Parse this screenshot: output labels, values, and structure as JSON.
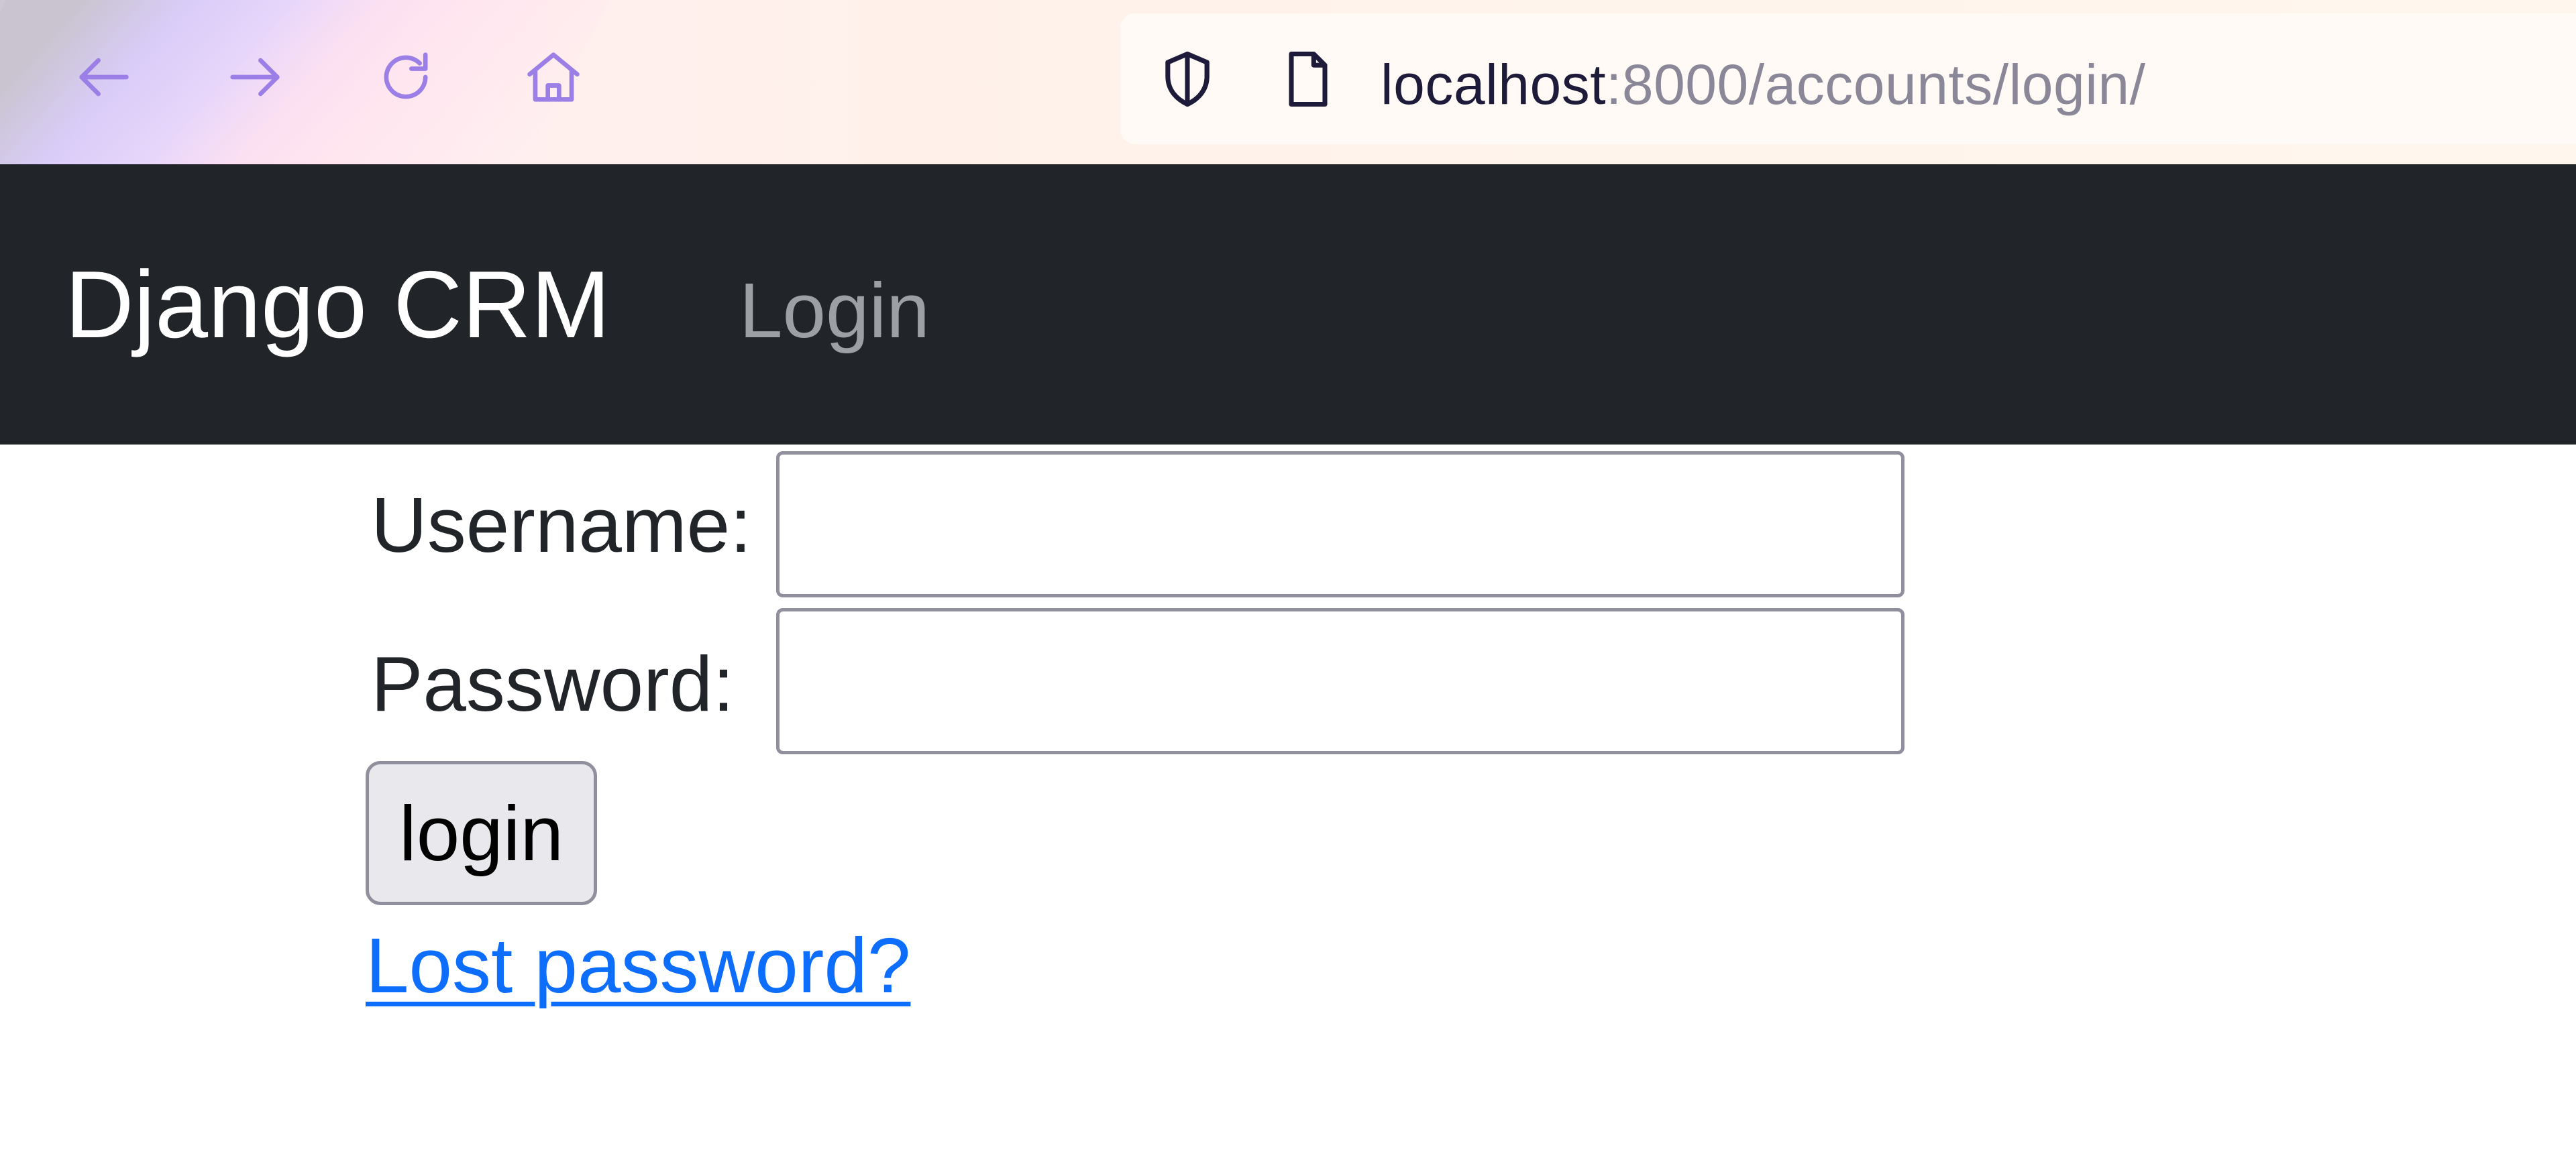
{
  "browser": {
    "url_host": "localhost",
    "url_path": ":8000/accounts/login/",
    "icons": [
      "back-arrow-icon",
      "forward-arrow-icon",
      "reload-icon",
      "home-icon",
      "shield-icon",
      "page-icon"
    ],
    "accent_color": "#9b7fe6"
  },
  "navbar": {
    "brand": "Django CRM",
    "link_login": "Login",
    "background_color": "#212529"
  },
  "form": {
    "username_label": "Username:",
    "username_value": "",
    "password_label": "Password:",
    "password_value": "",
    "submit_label": "login",
    "lost_password_link": "Lost password?",
    "link_color": "#0d6efd"
  }
}
